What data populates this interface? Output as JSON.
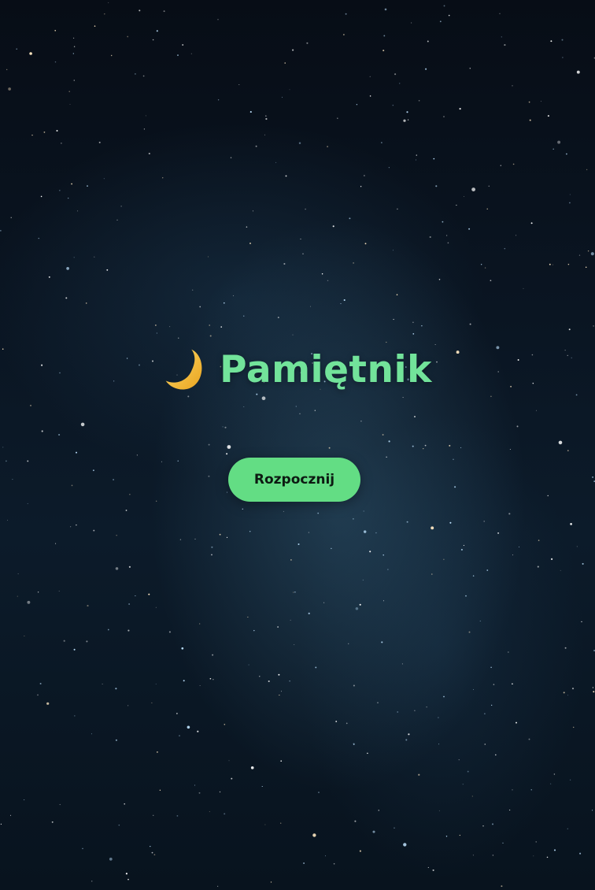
{
  "app": {
    "title": "Pamiętnik",
    "moon_icon": "crescent-moon-icon",
    "start_label": "Rozpocznij"
  },
  "colors": {
    "accent": "#72e39a",
    "button_bg": "#63dd84",
    "button_text": "#0d1a12",
    "sky_dark": "#070d16",
    "sky_mid": "#0c1b2a",
    "moon": "#f6c142"
  }
}
